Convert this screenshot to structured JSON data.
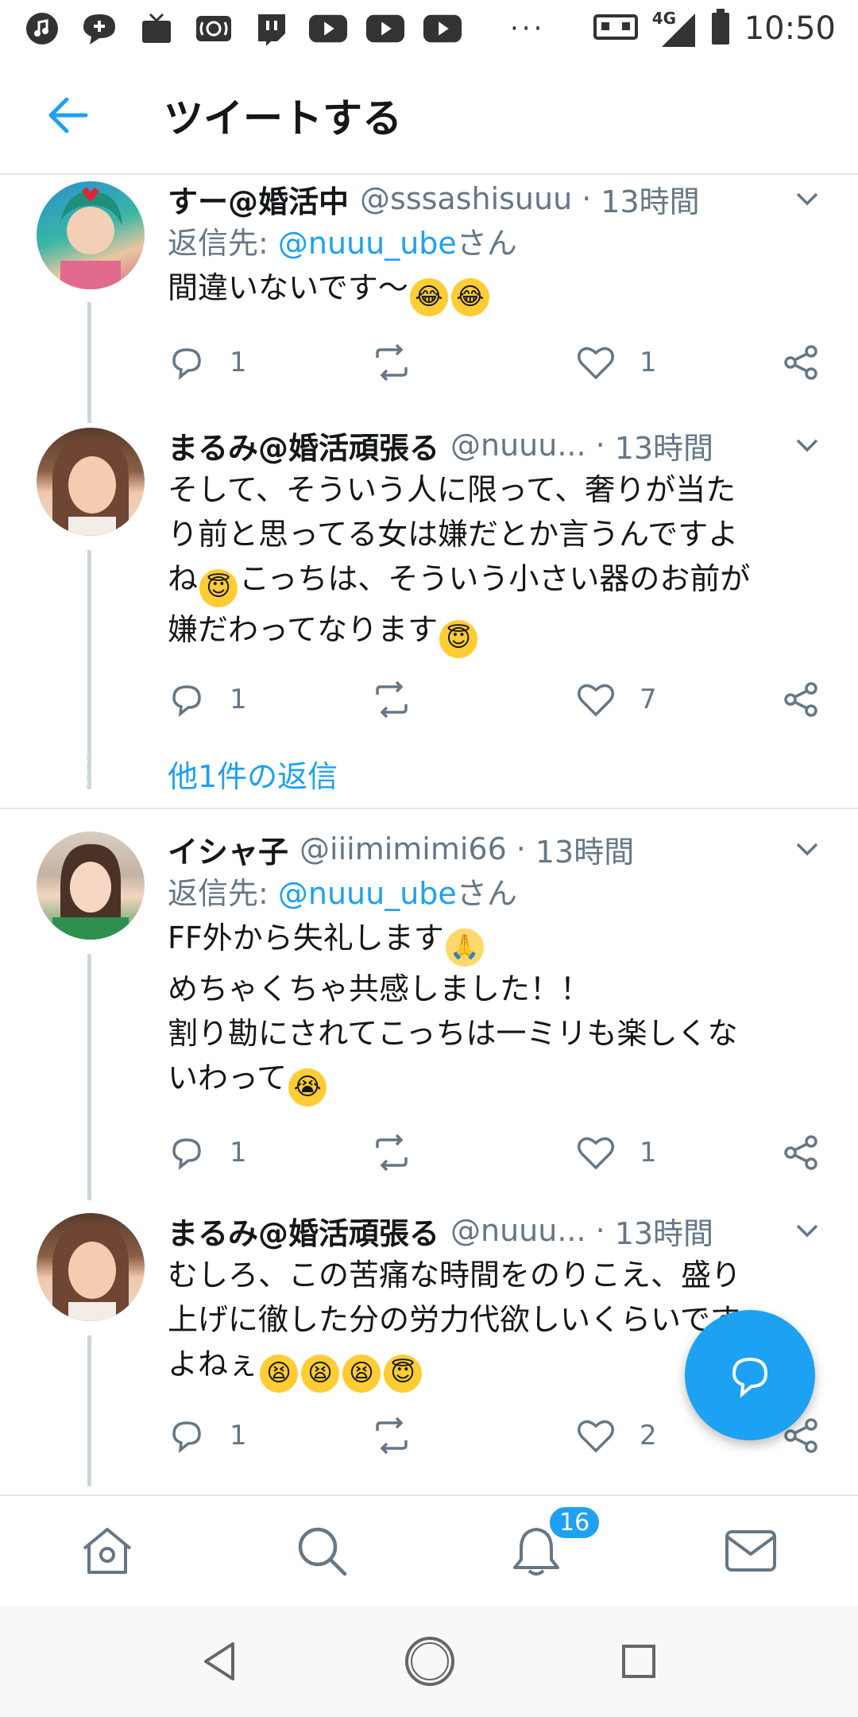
{
  "status_bar": {
    "network": "4G",
    "time": "10:50",
    "icons": [
      "music-icon",
      "chat-icon",
      "tv-icon",
      "radio-icon",
      "twitch-icon",
      "youtube-icon",
      "youtube-icon",
      "youtube-icon"
    ]
  },
  "app_bar": {
    "back_icon": "arrow-left-icon",
    "title": "ツイートする"
  },
  "tweets": [
    {
      "name": "すー@婚活中",
      "handle": "@sssashisuuu",
      "dot": "·",
      "time": "13時間",
      "reply_prefix": "返信先: ",
      "reply_to": "@nuuu_ube",
      "reply_suffix": "さん",
      "text": "間違いないです〜",
      "emojis": [
        "joy",
        "joy"
      ],
      "replies": "1",
      "retweets": "",
      "likes": "1"
    },
    {
      "name": "まるみ@婚活頑張る",
      "handle": "@nuuu...",
      "dot": "·",
      "time": "13時間",
      "text_line1": "そして、そういう人に限って、奢りが当た",
      "text_line2": "り前と思ってる女は嫌だとか言うんですよ",
      "text_line3a": "ね",
      "text_line3b": "こっちは、そういう小さい器のお前が",
      "text_line4": "嫌だわってなります",
      "replies": "1",
      "retweets": "",
      "likes": "7"
    },
    {
      "name": "イシャ子",
      "handle": "@iiimimimi66",
      "dot": "·",
      "time": "13時間",
      "reply_prefix": "返信先: ",
      "reply_to": "@nuuu_ube",
      "reply_suffix": "さん",
      "text_line1": "FF外から失礼します",
      "text_line2": "めちゃくちゃ共感しました！！",
      "text_line3": "割り勘にされてこっちは一ミリも楽しくな",
      "text_line4": "いわって",
      "replies": "1",
      "retweets": "",
      "likes": "1"
    },
    {
      "name": "まるみ@婚活頑張る",
      "handle": "@nuuu...",
      "dot": "·",
      "time": "13時間",
      "text_line1": "むしろ、この苦痛な時間をのりこえ、盛り",
      "text_line2": "上げに徹した分の労力代欲しいくらいです",
      "text_line3": "よねぇ",
      "replies": "1",
      "retweets": "",
      "likes": "2"
    }
  ],
  "more_replies": "他1件の返信",
  "bottom_nav": {
    "items": [
      "home-icon",
      "search-icon",
      "notifications-icon",
      "messages-icon"
    ],
    "notification_badge": "16"
  },
  "colors": {
    "accent": "#1da1f2",
    "text": "#14171a",
    "secondary": "#657786",
    "divider": "#e1e8ed"
  }
}
